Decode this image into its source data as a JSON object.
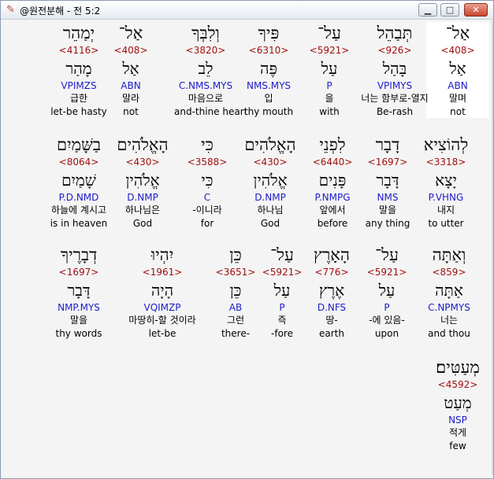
{
  "window": {
    "title": "@원전분해 - 전 5:2",
    "minimize": "▁",
    "maximize": "□",
    "close": "✕",
    "icon": "bible-app-icon"
  },
  "rows": [
    [
      {
        "heb": "אַל־",
        "strong": "<408>",
        "lemma": "אַל",
        "morph": "ABN",
        "kor": "말며",
        "eng": "not",
        "selected": true
      },
      {
        "heb": "תְּבַהֵל",
        "strong": "<926>",
        "lemma": "בָּהַל",
        "morph": "VPIMYS",
        "kor": "너는 함부로-열지",
        "eng": "Be-rash"
      },
      {
        "heb": "עַל־",
        "strong": "<5921>",
        "lemma": "עַל",
        "morph": "P",
        "kor": "을",
        "eng": "with"
      },
      {
        "heb": "פִּיךָ",
        "strong": "<6310>",
        "lemma": "פֶּה",
        "morph": "NMS.MYS",
        "kor": "입",
        "eng": "thy mouth"
      },
      {
        "heb": "וְלִבְּךָ",
        "strong": "<3820>",
        "lemma": "לֵב",
        "morph": "C.NMS.MYS",
        "kor": "마음으로",
        "eng": "and-thine heart"
      },
      {
        "heb": "אַל־",
        "strong": "<408>",
        "lemma": "אַל",
        "morph": "ABN",
        "kor": "말라",
        "eng": "not"
      },
      {
        "heb": "יְמַהֵר",
        "strong": "<4116>",
        "lemma": "מָהַר",
        "morph": "VPIMZS",
        "kor": "급한",
        "eng": "let-be hasty"
      }
    ],
    [
      {
        "heb": "לְהוֹצִיא",
        "strong": "<3318>",
        "lemma": "יָצָא",
        "morph": "P.VHNG",
        "kor": "내지",
        "eng": "to utter"
      },
      {
        "heb": "דָבָר",
        "strong": "<1697>",
        "lemma": "דָּבָר",
        "morph": "NMS",
        "kor": "말을",
        "eng": "any thing"
      },
      {
        "heb": "לִפְנֵי",
        "strong": "<6440>",
        "lemma": "פָּנִים",
        "morph": "P.NMPG",
        "kor": "앞에서",
        "eng": "before"
      },
      {
        "heb": "הָאֱלֹהִים",
        "strong": "<430>",
        "lemma": "אֱלֹהִין",
        "morph": "D.NMP",
        "kor": "하나님",
        "eng": "God"
      },
      {
        "heb": "כִּי",
        "strong": "<3588>",
        "lemma": "כִּי",
        "morph": "C",
        "kor": "-이니라",
        "eng": "for"
      },
      {
        "heb": "הָאֱלֹהִים",
        "strong": "<430>",
        "lemma": "אֱלֹהִין",
        "morph": "D.NMP",
        "kor": "하나님은",
        "eng": "God"
      },
      {
        "heb": "בַשָּׁמַיִם",
        "strong": "<8064>",
        "lemma": "שָׁמַיִם",
        "morph": "P.D.NMD",
        "kor": "하늘에 계시고",
        "eng": "is in heaven"
      }
    ],
    [
      {
        "heb": "וְאַתָּה",
        "strong": "<859>",
        "lemma": "אַתָּה",
        "morph": "C.NPMYS",
        "kor": "너는",
        "eng": "and thou"
      },
      {
        "heb": "עַל־",
        "strong": "<5921>",
        "lemma": "עַל",
        "morph": "P",
        "kor": "-에 있음-",
        "eng": "upon"
      },
      {
        "heb": "הָאָרֶץ",
        "strong": "<776>",
        "lemma": "אֶרֶץ",
        "morph": "D.NFS",
        "kor": "땅-",
        "eng": "earth"
      },
      {
        "heb": "עַל־",
        "strong": "<5921>",
        "lemma": "עַל",
        "morph": "P",
        "kor": "즉",
        "eng": "-fore"
      },
      {
        "heb": "כֵּן",
        "strong": "<3651>",
        "lemma": "כֵּן",
        "morph": "AB",
        "kor": "그런",
        "eng": "there-"
      },
      {
        "heb": "יִהְיוּ",
        "strong": "<1961>",
        "lemma": "הָיָה",
        "morph": "VQIMZP",
        "kor": "마땅히-할 것이라",
        "eng": "let-be"
      },
      {
        "heb": "דְבָרֶיךָ",
        "strong": "<1697>",
        "lemma": "דָּבָר",
        "morph": "NMP.MYS",
        "kor": "말을",
        "eng": "thy words"
      }
    ],
    [
      {
        "heb": "מְעַטִּים׃",
        "strong": "<4592>",
        "lemma": "מְעַט",
        "morph": "NSP",
        "kor": "적게",
        "eng": "few"
      }
    ]
  ]
}
